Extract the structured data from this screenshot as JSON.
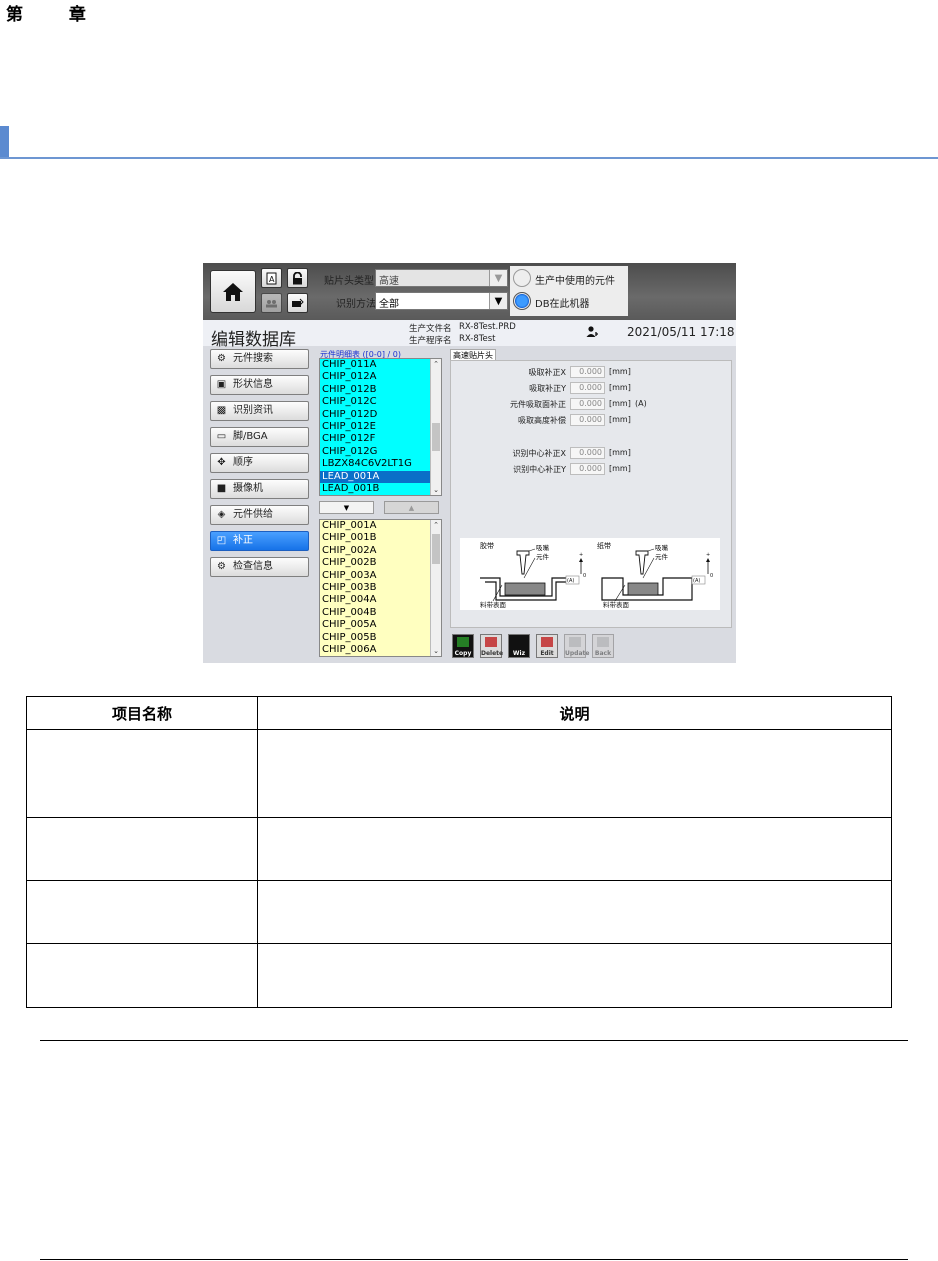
{
  "doc": {
    "chapter": "第 章",
    "table_headers": [
      "项目名称",
      "说明"
    ],
    "table_rows": [
      {
        "name": "",
        "desc": ""
      },
      {
        "name": "",
        "desc": ""
      },
      {
        "name": "",
        "desc": ""
      },
      {
        "name": "",
        "desc": ""
      }
    ]
  },
  "app": {
    "toolbar": {
      "head_type_label": "贴片头类型",
      "head_type_value": "高速",
      "recog_method_label": "识别方法",
      "recog_method_value": "全部",
      "radio_in_production": "生产中使用的元件",
      "radio_db_machine": "DB在此机器",
      "selected_radio": "radio_db_machine"
    },
    "title": "编辑数据库",
    "prod_file_label": "生产文件名",
    "prod_file_value": "RX-8Test.PRD",
    "prog_label": "生产程序名",
    "prog_value": "RX-8Test",
    "datetime": "2021/05/11 17:18",
    "nav": [
      {
        "label": "元件搜索",
        "icon": "part-search-icon",
        "active": false
      },
      {
        "label": "形状信息",
        "icon": "shape-info-icon",
        "active": false
      },
      {
        "label": "识别资讯",
        "icon": "recognition-icon",
        "active": false
      },
      {
        "label": "脚/BGA",
        "icon": "chip-lead-icon",
        "active": false
      },
      {
        "label": "顺序",
        "icon": "sequence-icon",
        "active": false
      },
      {
        "label": "摄像机",
        "icon": "camera-icon",
        "active": false
      },
      {
        "label": "元件供给",
        "icon": "feeder-icon",
        "active": false
      },
      {
        "label": "补正",
        "icon": "offset-icon",
        "active": true
      },
      {
        "label": "检查信息",
        "icon": "inspection-icon",
        "active": false
      }
    ],
    "list_header": "元件明细表 ([0-0] / 0)",
    "list_top": [
      "CHIP_011A",
      "CHIP_012A",
      "CHIP_012B",
      "CHIP_012C",
      "CHIP_012D",
      "CHIP_012E",
      "CHIP_012F",
      "CHIP_012G",
      "LBZX84C6V2LT1G",
      "LEAD_001A",
      "LEAD_001B"
    ],
    "list_top_selected": "LEAD_001A",
    "list_bottom": [
      "CHIP_001A",
      "CHIP_001B",
      "CHIP_002A",
      "CHIP_002B",
      "CHIP_003A",
      "CHIP_003B",
      "CHIP_004A",
      "CHIP_004B",
      "CHIP_005A",
      "CHIP_005B",
      "CHIP_006A"
    ],
    "move_down": "▼",
    "move_up": "▲",
    "tab_label": "高速贴片头",
    "fields": [
      {
        "label": "吸取补正X",
        "value": "0.000",
        "unit": "[mm]",
        "extra": ""
      },
      {
        "label": "吸取补正Y",
        "value": "0.000",
        "unit": "[mm]",
        "extra": ""
      },
      {
        "label": "元件吸取面补正",
        "value": "0.000",
        "unit": "[mm]",
        "extra": "(A)"
      },
      {
        "label": "吸取高度补偿",
        "value": "0.000",
        "unit": "[mm]",
        "extra": ""
      },
      {
        "label": "识别中心补正X",
        "value": "0.000",
        "unit": "[mm]",
        "extra": ""
      },
      {
        "label": "识别中心补正Y",
        "value": "0.000",
        "unit": "[mm]",
        "extra": ""
      }
    ],
    "diagram": {
      "left_title": "胶带",
      "right_title": "纸带",
      "nozzle": "吸嘴",
      "part": "元件",
      "surface": "料带表面",
      "dim": "(A)",
      "plus": "+",
      "zero": "0"
    },
    "tools": [
      {
        "label": "Copy",
        "enabled": true
      },
      {
        "label": "Delete",
        "enabled": true
      },
      {
        "label": "Wiz",
        "enabled": true
      },
      {
        "label": "Edit",
        "enabled": true
      },
      {
        "label": "Update",
        "enabled": false
      },
      {
        "label": "Back",
        "enabled": false
      }
    ],
    "colors": {
      "accent": "#1672e8",
      "list_cyan": "#00ffff",
      "list_yellow": "#ffffc0",
      "selection": "#0a6fc8"
    }
  }
}
